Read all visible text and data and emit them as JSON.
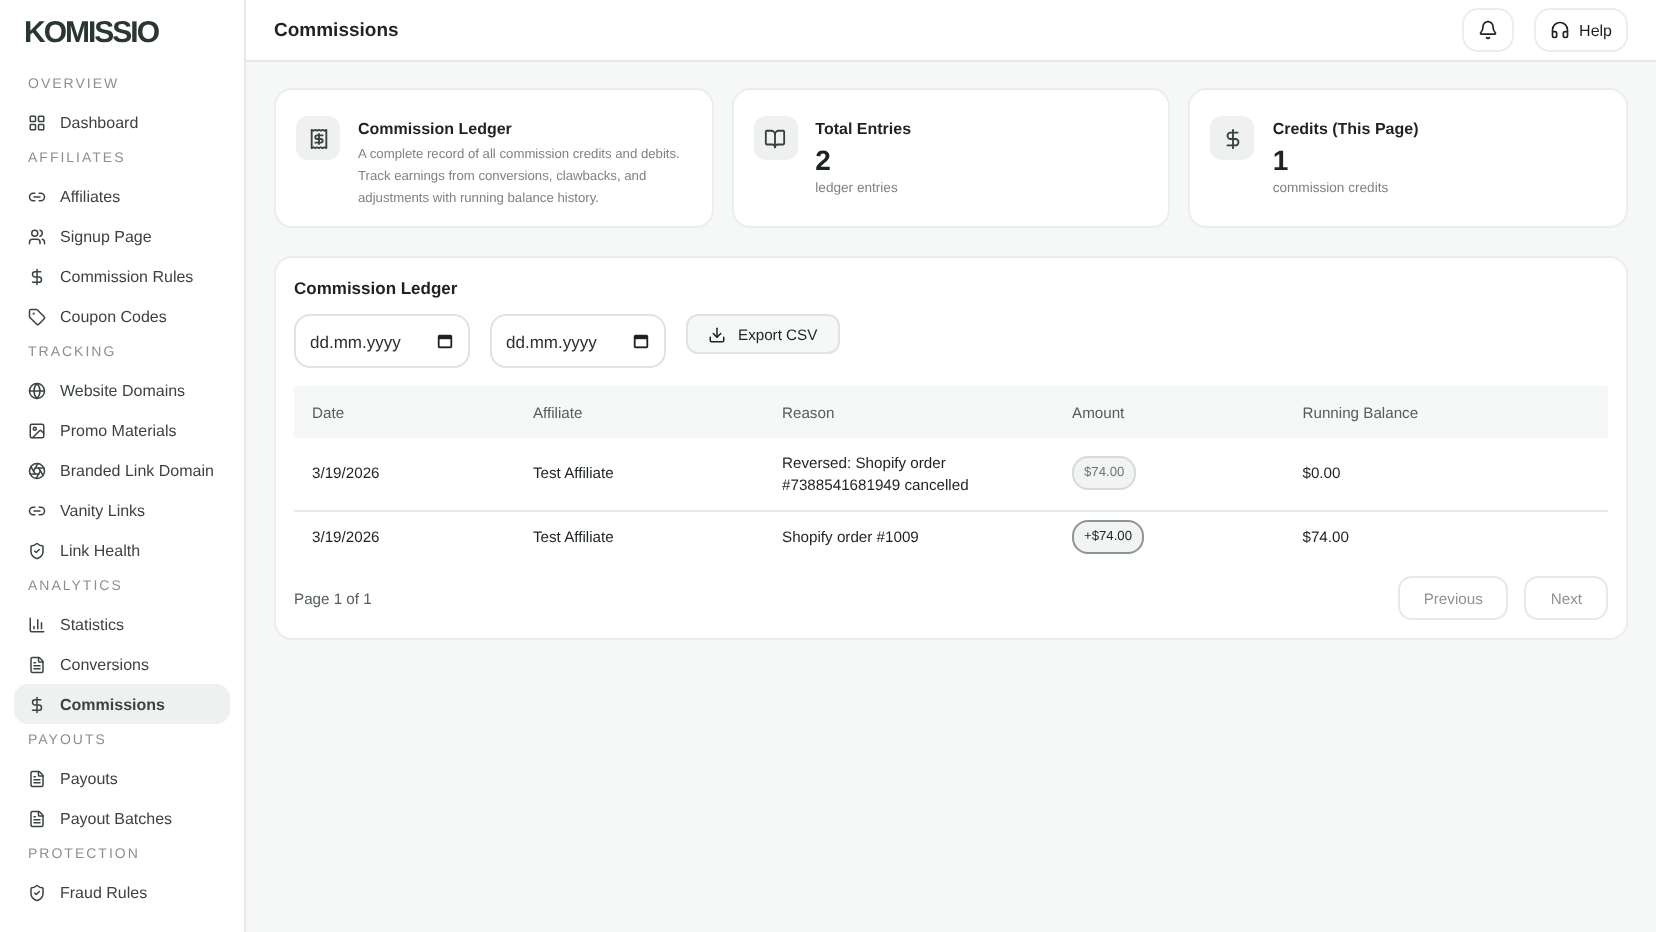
{
  "brand": "KOMISSIO",
  "sidebar": {
    "sections": [
      {
        "title": "OVERVIEW",
        "items": [
          {
            "label": "Dashboard",
            "selected": false
          }
        ]
      },
      {
        "title": "AFFILIATES",
        "items": [
          {
            "label": "Affiliates",
            "selected": false
          },
          {
            "label": "Signup Page",
            "selected": false
          },
          {
            "label": "Commission Rules",
            "selected": false
          },
          {
            "label": "Coupon Codes",
            "selected": false
          }
        ]
      },
      {
        "title": "TRACKING",
        "items": [
          {
            "label": "Website Domains",
            "selected": false
          },
          {
            "label": "Promo Materials",
            "selected": false
          },
          {
            "label": "Branded Link Domain",
            "selected": false
          },
          {
            "label": "Vanity Links",
            "selected": false
          },
          {
            "label": "Link Health",
            "selected": false
          }
        ]
      },
      {
        "title": "ANALYTICS",
        "items": [
          {
            "label": "Statistics",
            "selected": false
          },
          {
            "label": "Conversions",
            "selected": false
          },
          {
            "label": "Commissions",
            "selected": true
          }
        ]
      },
      {
        "title": "PAYOUTS",
        "items": [
          {
            "label": "Payouts",
            "selected": false
          },
          {
            "label": "Payout Batches",
            "selected": false
          }
        ]
      },
      {
        "title": "PROTECTION",
        "items": [
          {
            "label": "Fraud Rules",
            "selected": false
          }
        ]
      }
    ]
  },
  "header": {
    "title": "Commissions",
    "help": "Help"
  },
  "cards": [
    {
      "kind": "description",
      "title": "Commission Ledger",
      "text": "A complete record of all commission credits and debits. Track earnings from conversions, clawbacks, and adjustments with running balance history."
    },
    {
      "kind": "stat",
      "title": "Total Entries",
      "value": "2",
      "caption": "ledger entries"
    },
    {
      "kind": "stat",
      "title": "Credits (This Page)",
      "value": "1",
      "caption": "commission credits"
    }
  ],
  "ledger": {
    "title": "Commission Ledger",
    "date_from": {
      "placeholder": "dd.mm.yyyy"
    },
    "date_to": {
      "placeholder": "dd.mm.yyyy"
    },
    "export": "Export CSV",
    "columns": [
      "Date",
      "Affiliate",
      "Reason",
      "Amount",
      "Running Balance"
    ],
    "rows": [
      {
        "date": "3/19/2026",
        "affiliate": "Test Affiliate",
        "reason": "Reversed: Shopify order #7388541681949 cancelled",
        "amount": "$74.00",
        "kind": "debit",
        "balance": "$0.00"
      },
      {
        "date": "3/19/2026",
        "affiliate": "Test Affiliate",
        "reason": "Shopify order #1009",
        "amount": "+$74.00",
        "kind": "credit",
        "balance": "$74.00"
      }
    ],
    "page": "Page 1 of 1",
    "previous": {
      "label": "Previous",
      "disabled": true
    },
    "next": {
      "label": "Next",
      "disabled": true
    }
  }
}
